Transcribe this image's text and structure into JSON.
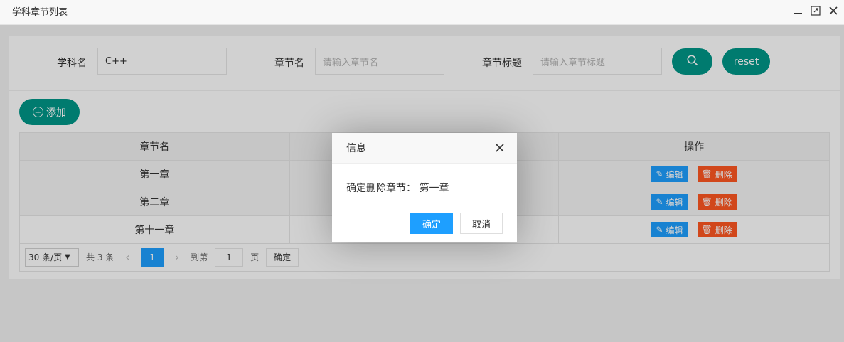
{
  "window": {
    "title": "学科章节列表"
  },
  "search": {
    "subject_label": "学科名",
    "subject_value": "C++",
    "chapter_label": "章节名",
    "chapter_placeholder": "请输入章节名",
    "title_label": "章节标题",
    "title_placeholder": "请输入章节标题",
    "reset_label": "reset"
  },
  "toolbar": {
    "add_label": "添加"
  },
  "table": {
    "columns": [
      "章节名",
      "",
      "操作"
    ],
    "rows": [
      {
        "name": "第一章"
      },
      {
        "name": "第二章"
      },
      {
        "name": "第十一章"
      }
    ],
    "edit_label": "编辑",
    "delete_label": "删除"
  },
  "pager": {
    "per_page": "30 条/页",
    "total": "共 3 条",
    "current_page": "1",
    "goto_label": "到第",
    "goto_value": "1",
    "page_suffix": "页",
    "confirm_label": "确定"
  },
  "dialog": {
    "title": "信息",
    "message": "确定删除章节：  第一章",
    "ok_label": "确定",
    "cancel_label": "取消"
  },
  "colors": {
    "primary_teal": "#009688",
    "blue": "#1e9fff",
    "danger": "#ff5722"
  }
}
